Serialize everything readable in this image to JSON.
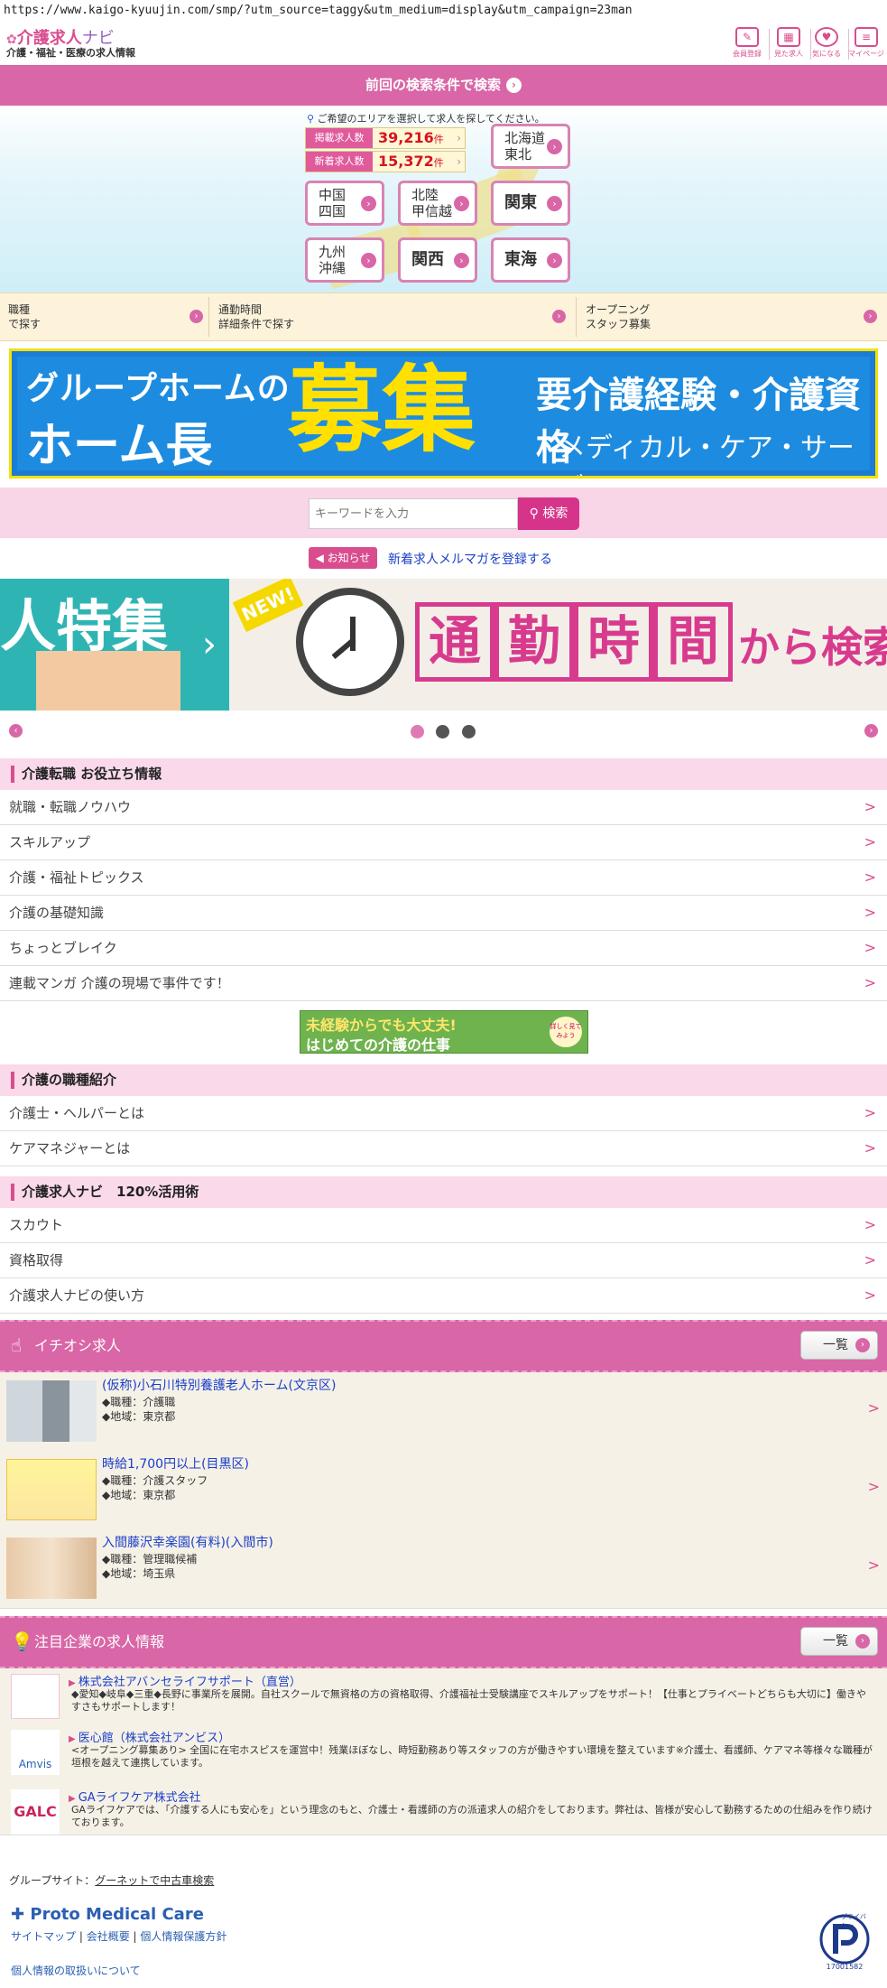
{
  "url": "https://www.kaigo-kyuujin.com/smp/?utm_source=taggy&utm_medium=display&utm_campaign=23man",
  "header": {
    "logo_main": "介護求人",
    "logo_navi": "ナビ",
    "logo_sub": "介護・福祉・医療の求人情報",
    "icons": [
      {
        "label": "会員登録",
        "icon": "pencil-icon"
      },
      {
        "label": "見た求人",
        "icon": "calendar-icon"
      },
      {
        "label": "気になる",
        "icon": "heart-icon"
      },
      {
        "label": "マイページ",
        "icon": "mypage-icon"
      }
    ]
  },
  "prev_search": {
    "label": "前回の検索条件で検索"
  },
  "area": {
    "hint": "ご希望のエリアを選択して求人を探してください。",
    "stats": [
      {
        "label": "掲載求人数",
        "value": "39,216",
        "unit": "件"
      },
      {
        "label": "新着求人数",
        "value": "15,372",
        "unit": "件"
      }
    ],
    "buttons": [
      {
        "line1": "北海道",
        "line2": "東北"
      },
      {
        "line1": "中国",
        "line2": "四国"
      },
      {
        "line1": "北陸",
        "line2": "甲信越"
      },
      {
        "line1": "関東",
        "line2": ""
      },
      {
        "line1": "九州",
        "line2": "沖縄"
      },
      {
        "line1": "関西",
        "line2": ""
      },
      {
        "line1": "東海",
        "line2": ""
      }
    ]
  },
  "search_tabs": [
    {
      "line1": "職種",
      "line2": "で探す"
    },
    {
      "line1": "通勤時間",
      "line2": "詳細条件で探す"
    },
    {
      "line1": "オープニング",
      "line2": "スタッフ募集"
    }
  ],
  "banner": {
    "line1": "グループホームの",
    "line2": "ホーム長",
    "big": "募集",
    "right1": "要介護経験・介護資格",
    "right2": "メディカル・ケア・サービス"
  },
  "keyword": {
    "placeholder": "キーワードを入力",
    "button": "検索"
  },
  "notice": {
    "badge": "お知らせ",
    "link": "新着求人メルマガを登録する"
  },
  "slider": {
    "left_text": "人特集",
    "new_badge": "NEW!",
    "kanji": [
      "通",
      "勤",
      "時",
      "間"
    ],
    "tail": "から検索",
    "active_dot": 0,
    "dots": 3
  },
  "sections": [
    {
      "title": "介護転職 お役立ち情報",
      "items": [
        "就職・転職ノウハウ",
        "スキルアップ",
        "介護・福祉トピックス",
        "介護の基礎知識",
        "ちょっとブレイク",
        "連載マンガ 介護の現場で事件です！"
      ]
    },
    {
      "title": "介護の職種紹介",
      "items": [
        "介護士・ヘルパーとは",
        "ケアマネジャーとは"
      ]
    },
    {
      "title": "介護求人ナビ　120%活用術",
      "items": [
        "スカウト",
        "資格取得",
        "介護求人ナビの使い方"
      ]
    }
  ],
  "mikeiken": {
    "line1": "未経験からでも大丈夫!",
    "line2": "はじめての介護の仕事",
    "badge": "詳しく見てみよう"
  },
  "pickup": {
    "title": "イチオシ求人",
    "more": "一覧",
    "items": [
      {
        "title": "(仮称)小石川特別養護老人ホーム(文京区)",
        "job": "◆職種：介護職",
        "region": "◆地域：東京都"
      },
      {
        "title": "時給1,700円以上(目黒区)",
        "job": "◆職種：介護スタッフ",
        "region": "◆地域：東京都"
      },
      {
        "title": "入間藤沢幸楽園(有料)(入間市)",
        "job": "◆職種：管理職候補",
        "region": "◆地域：埼玉県"
      }
    ]
  },
  "companies": {
    "title": "注目企業の求人情報",
    "more": "一覧",
    "items": [
      {
        "name": "株式会社アバンセライフサポート（直営）",
        "logo": "",
        "desc": "◆愛知◆岐阜◆三重◆長野に事業所を展開。自社スクールで無資格の方の資格取得、介護福祉士受験講座でスキルアップをサポート！【仕事とプライベートどちらも大切に】働きやすさもサポートします！"
      },
      {
        "name": "医心館（株式会社アンビス）",
        "logo": "Amvis",
        "desc": "<オープニング募集あり> 全国に在宅ホスピスを運営中！残業ほぼなし、時短勤務あり等スタッフの方が働きやすい環境を整えています※介護士、看護師、ケアマネ等様々な職種が垣根を越えて連携しています。"
      },
      {
        "name": "GAライフケア株式会社",
        "logo": "GALC",
        "desc": "GAライフケアでは、「介護する人にも安心を」という理念のもと、介護士・看護師の方の派遣求人の紹介をしております。弊社は、皆様が安心して勤務するための仕組みを作り続けております。"
      }
    ]
  },
  "footer": {
    "group_label": "グループサイト：",
    "group_link": "グーネットで中古車検索",
    "company": "Proto Medical Care",
    "links": [
      "サイトマップ",
      "会社概要",
      "個人情報保護方針"
    ],
    "privacy_link": "個人情報の取扱いについて",
    "pmark_number": "17001582",
    "pmark_text": "プライバシー"
  },
  "colors": {
    "brand_pink": "#d966a6",
    "accent_magenta": "#d6348b",
    "bg_beige": "#f6f1e7"
  }
}
